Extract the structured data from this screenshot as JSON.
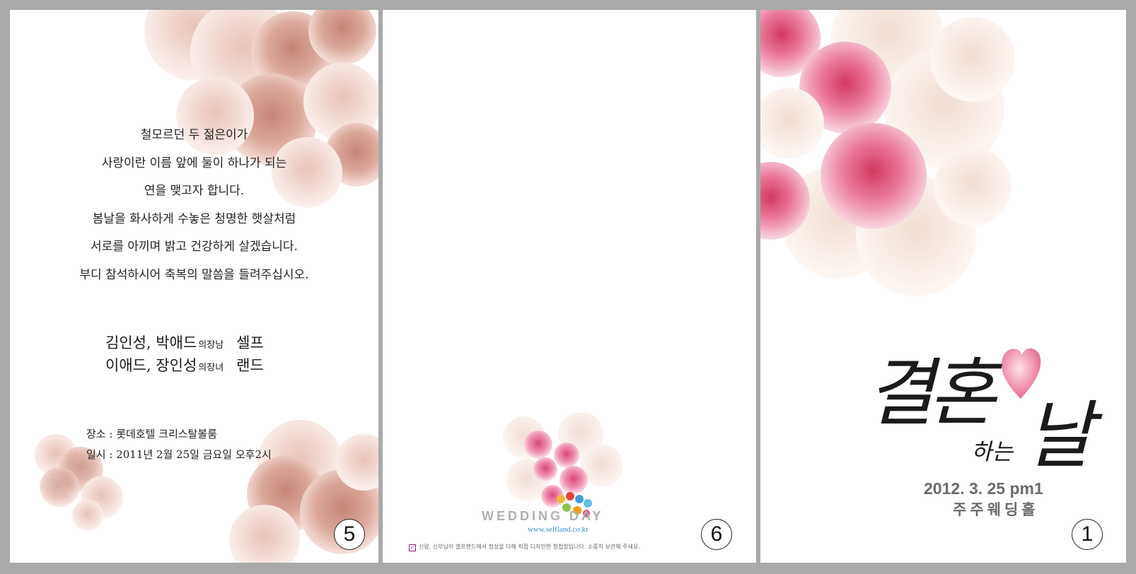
{
  "colors": {
    "background": "#a9a9a9",
    "panel": "#ffffff",
    "peach_rose": "#d9a090",
    "pink_rose": "#e8789c",
    "date_text": "#6b6b6b"
  },
  "panel5": {
    "poem": [
      "철모르던 두 젊은이가",
      "사랑이란 이름 앞에 둘이 하나가 되는",
      "연을 맺고자 합니다.",
      "봄날을 화사하게 수놓은 청명한 햇살처럼",
      "서로를 아끼며 밝고 건강하게 살겠습니다.",
      "부디 참석하시어 축복의 말씀을 들려주십시오."
    ],
    "names": {
      "groom_parents": "김인성, 박애드",
      "groom_relation": "의장남",
      "groom": "셀프",
      "bride_parents": "이애드, 장인성",
      "bride_relation": "의장녀",
      "bride": "랜드"
    },
    "place": "장소 : 롯데호텔 크리스탈볼룸",
    "datetime": "일시 : 2011년 2월 25일 금요일 오후2시",
    "page_number": "5"
  },
  "panel6": {
    "logo_text": "WEDDING DAY",
    "logo_url": "www.selfland.co.kr",
    "notice": "신랑, 신부님이 셀프랜드에서 정성을 다해 직접 디자인한 청첩장입니다. 소중히 보관해 주세요.",
    "page_number": "6"
  },
  "panel1": {
    "title_main": "결혼",
    "title_small": "하는",
    "title_day": "날",
    "date": "2012. 3. 25 pm1",
    "venue": "주주웨딩홀",
    "page_number": "1"
  }
}
